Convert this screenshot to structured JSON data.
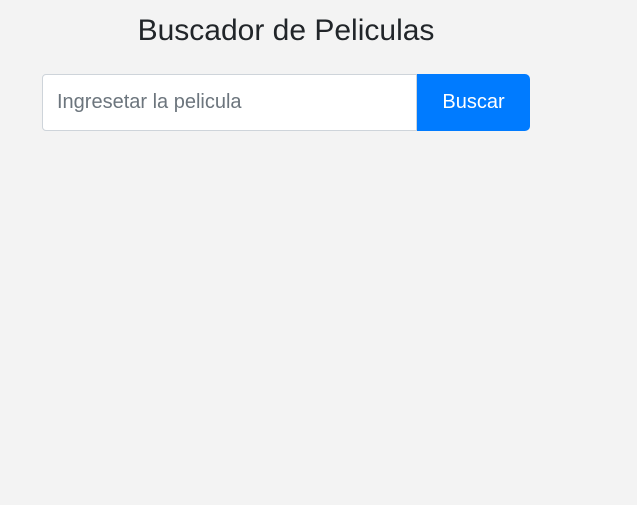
{
  "header": {
    "title": "Buscador de Peliculas"
  },
  "search": {
    "placeholder": "Ingresetar la pelicula",
    "value": "",
    "button_label": "Buscar"
  },
  "colors": {
    "background": "#f3f3f3",
    "button_primary": "#007bff",
    "text": "#212529"
  }
}
